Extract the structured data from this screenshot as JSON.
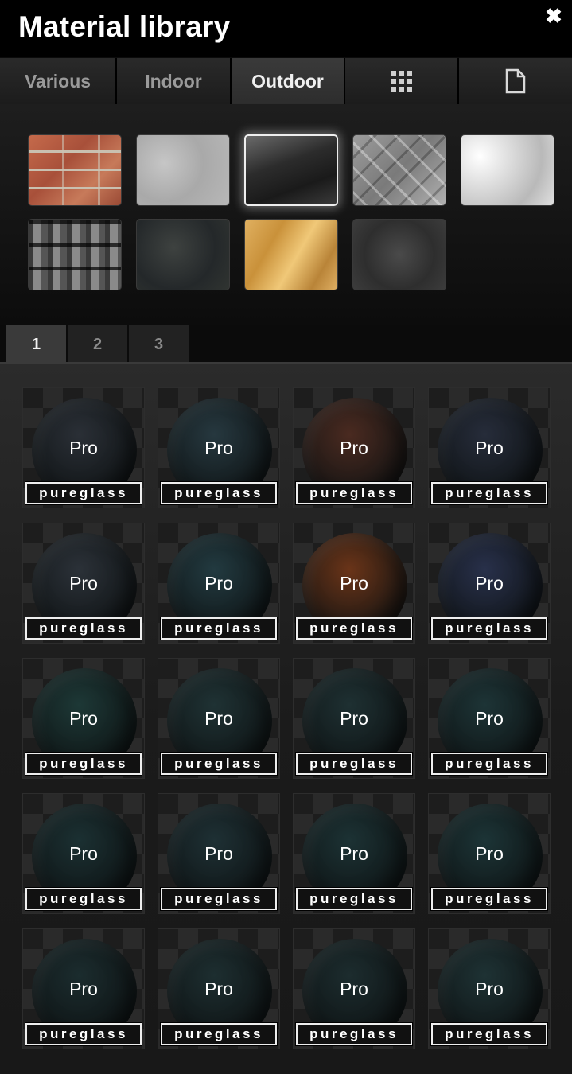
{
  "window": {
    "title": "Material library",
    "close_icon": "close-icon"
  },
  "category_tabs": [
    {
      "label": "Various",
      "active": false
    },
    {
      "label": "Indoor",
      "active": false
    },
    {
      "label": "Outdoor",
      "active": true
    },
    {
      "icon": "grid-icon",
      "active": false
    },
    {
      "icon": "document-icon",
      "active": false
    }
  ],
  "textures": [
    {
      "name": "brick",
      "selected": false
    },
    {
      "name": "concrete",
      "selected": false
    },
    {
      "name": "glass",
      "selected": true
    },
    {
      "name": "diamond-plate",
      "selected": false
    },
    {
      "name": "plaster",
      "selected": false
    },
    {
      "name": "roof-tiles",
      "selected": false
    },
    {
      "name": "granite",
      "selected": false
    },
    {
      "name": "osb-wood",
      "selected": false
    },
    {
      "name": "asphalt",
      "selected": false
    }
  ],
  "page_tabs": [
    {
      "label": "1",
      "active": true
    },
    {
      "label": "2",
      "active": false
    },
    {
      "label": "3",
      "active": false
    }
  ],
  "swatch_text": {
    "pro": "Pro",
    "badge": "pureglass"
  },
  "swatch_tints": [
    "#2a2f36",
    "#26383f",
    "#4a2a20",
    "#262c3a",
    "#2b3138",
    "#223a40",
    "#6a3418",
    "#28304a",
    "#1d3836",
    "#1f3234",
    "#1e3032",
    "#1d3436",
    "#1b3032",
    "#1e3034",
    "#1c3234",
    "#1c3436",
    "#1b2c2e",
    "#1d2e30",
    "#1c2c2e",
    "#1e3234"
  ]
}
